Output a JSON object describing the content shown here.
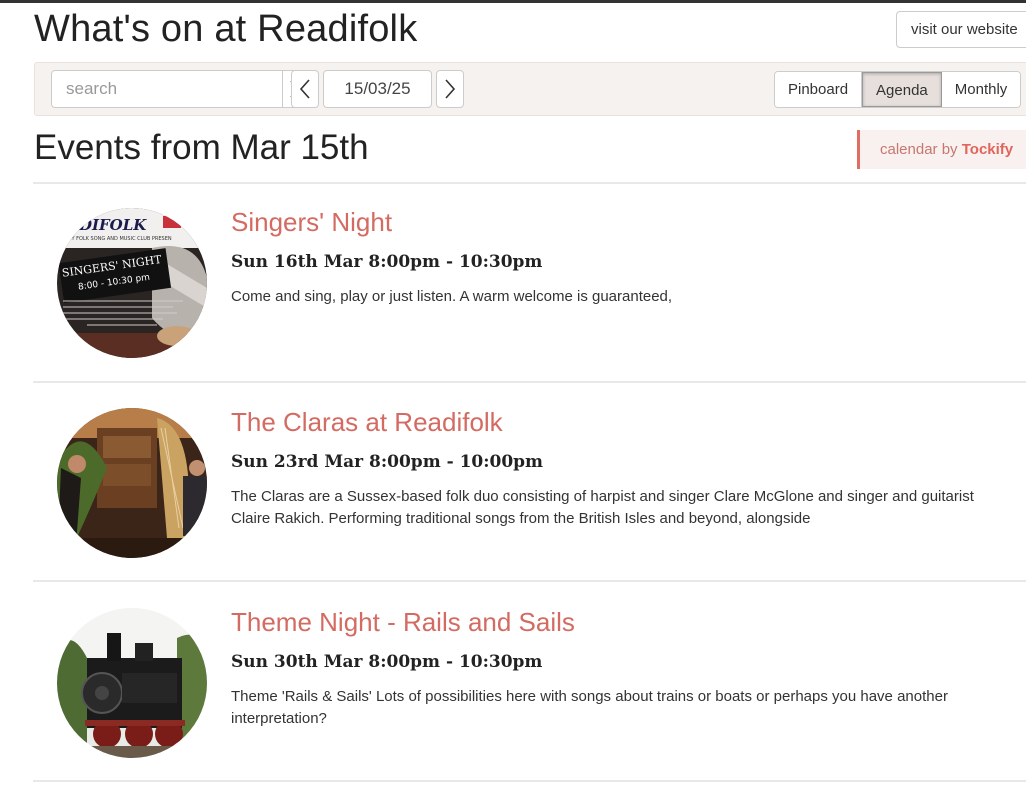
{
  "header": {
    "title": "What's on at Readifolk",
    "visit_label": "visit our website"
  },
  "toolbar": {
    "search_placeholder": "search",
    "date": "15/03/25",
    "views": [
      {
        "label": "Pinboard",
        "active": false
      },
      {
        "label": "Agenda",
        "active": true
      },
      {
        "label": "Monthly",
        "active": false
      }
    ]
  },
  "events_heading": "Events from Mar 15th",
  "badge": {
    "prefix": "calendar by",
    "brand": "Tockify"
  },
  "events": [
    {
      "title": "Singers' Night",
      "time": "Sun 16th Mar 8:00pm - 10:30pm",
      "description": "Come and sing, play or just listen. A warm welcome is guaranteed,",
      "poster": {
        "brand": "DIFOLK",
        "tagline": "KEY FOLK SONG AND MUSIC CLUB PRESEN",
        "heading": "SINGERS' NIGHT",
        "hours": "8:00 - 10:30 pm"
      }
    },
    {
      "title": "The Claras at Readifolk",
      "time": "Sun 23rd Mar 8:00pm - 10:00pm",
      "description": "The Claras are a Sussex-based folk duo consisting of harpist and singer Clare McGlone and singer and guitarist Claire Rakich. Performing traditional songs from the British Isles and beyond, alongside"
    },
    {
      "title": "Theme Night - Rails and Sails",
      "time": "Sun 30th Mar 8:00pm - 10:30pm",
      "description": "Theme 'Rails & Sails' Lots of possibilities here with songs about trains or boats or perhaps you have another interpretation?"
    }
  ],
  "colors": {
    "accent": "#d46b62",
    "toolbar_bg": "#f6f2ef"
  }
}
